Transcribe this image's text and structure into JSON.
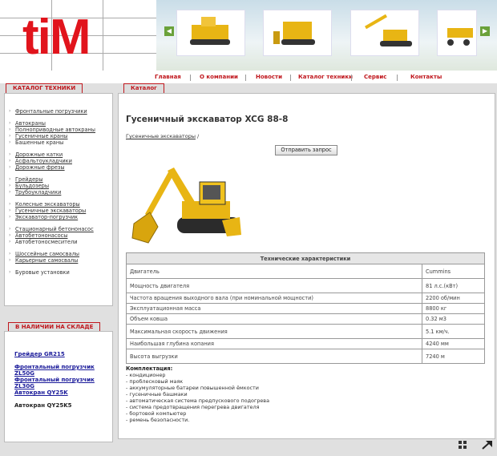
{
  "brand": {
    "logo_text": "tiM"
  },
  "nav": [
    "Главная",
    "О компании",
    "Новости",
    "Каталог техники",
    "Сервис",
    "Контакты"
  ],
  "sidebar": {
    "title": "КАТАЛОГ ТЕХНИКИ",
    "items": [
      {
        "label": "Фронтальные погрузчики",
        "link": true
      },
      {
        "gap": true
      },
      {
        "label": "Автокраны",
        "link": true
      },
      {
        "label": "Полноприводные автокраны",
        "link": true
      },
      {
        "label": "Гусеничные краны",
        "link": true
      },
      {
        "label": "Башенные краны",
        "link": false
      },
      {
        "gap": true
      },
      {
        "label": "Дорожные катки",
        "link": true
      },
      {
        "label": "Асфальтоукладчики",
        "link": true
      },
      {
        "label": "Дорожные фрезы",
        "link": true
      },
      {
        "gap": true
      },
      {
        "label": "Грейдеры",
        "link": true
      },
      {
        "label": "Бульдозеры",
        "link": true
      },
      {
        "label": "Трубоукладчики",
        "link": true
      },
      {
        "gap": true
      },
      {
        "label": "Колесные экскаваторы",
        "link": true
      },
      {
        "label": "Гусеничные экскаваторы",
        "link": true
      },
      {
        "label": "Экскаватор-погрузчик",
        "link": true
      },
      {
        "gap": true
      },
      {
        "label": "Стационарный бетононасос",
        "link": true
      },
      {
        "label": "Автобетононасосы",
        "link": true
      },
      {
        "label": "Автобетоносмесители",
        "link": false
      },
      {
        "gap": true
      },
      {
        "label": "Шоссейные самосвалы",
        "link": true
      },
      {
        "label": "Карьерные самосвалы",
        "link": true
      },
      {
        "gap": true
      },
      {
        "label": "Буровые установки",
        "link": false
      }
    ]
  },
  "stock": {
    "title": "В НАЛИЧИИ НА СКЛАДЕ",
    "items": [
      {
        "label": "Грейдер GR215",
        "link": true
      },
      {
        "label": "Фронтальный погрузчик ZL50G",
        "link": true
      },
      {
        "label": "Фронтальный погрузчик ZL30G",
        "link": true
      },
      {
        "label": "Автокран QY25K",
        "link": true
      },
      {
        "label": "Автокран QY25K5",
        "link": false
      }
    ]
  },
  "content": {
    "tab": "Каталог",
    "title": "Гусеничный экскаватор XCG 88-8",
    "breadcrumb_link": "Гусеничные экскаваторы",
    "breadcrumb_sep": "/",
    "request_button": "Отправить запрос",
    "specs_title": "Технические характеристики",
    "specs": [
      {
        "name": "Двигатель",
        "value": "Cummins"
      },
      {
        "name": "Мощность двигателя",
        "value": "81 л.с.(кВт)"
      },
      {
        "name": "Частота вращения выходного вала (при номинальной мощности)",
        "value": "2200 об/мин"
      },
      {
        "name": "Эксплуатационная масса",
        "value": "8800 кг"
      },
      {
        "name": "Объем ковша",
        "value": "0.32 м3"
      },
      {
        "name": "Максимальная скорость движения",
        "value": "5.1 км/ч."
      },
      {
        "name": "Наибольшая глубина копания",
        "value": "4240 мм"
      },
      {
        "name": "Высота выгрузки",
        "value": "7240 м"
      }
    ],
    "equipment_title": "Комплектация:",
    "equipment": [
      "- кондиционер",
      "- проблесковый маяк",
      "- аккумуляторные батареи повышенной ёмкости",
      "- гусеничные башмаки",
      "- автоматическая система предпускового подогрева",
      "- система предотвращения перегрева двигателя",
      "- бортовой компьютер",
      "- ремень безопасности."
    ]
  },
  "colors": {
    "brand_red": "#e1141c",
    "nav_red": "#c0171d",
    "link_blue": "#1a1a9a",
    "machine_yellow": "#e8b514"
  }
}
